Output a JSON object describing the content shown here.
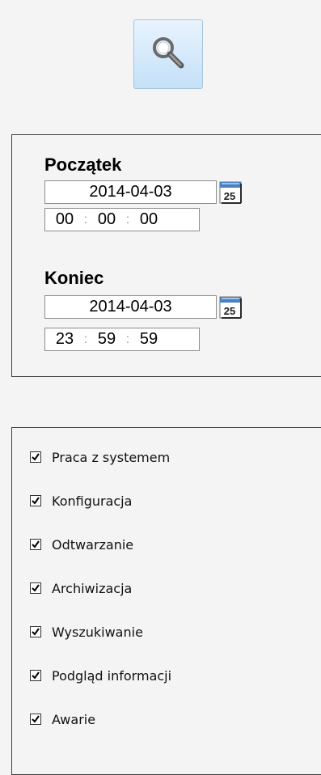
{
  "search": {
    "icon": "magnifier-icon"
  },
  "dates": {
    "start": {
      "label": "Początek",
      "date": "2014-04-03",
      "hours": "00",
      "minutes": "00",
      "seconds": "00"
    },
    "end": {
      "label": "Koniec",
      "date": "2014-04-03",
      "hours": "23",
      "minutes": "59",
      "seconds": "59"
    },
    "time_separator": ":",
    "calendar_icon_text": "25"
  },
  "filters": [
    {
      "label": "Praca z systemem",
      "checked": true
    },
    {
      "label": "Konfiguracja",
      "checked": true
    },
    {
      "label": "Odtwarzanie",
      "checked": true
    },
    {
      "label": "Archiwizacja",
      "checked": true
    },
    {
      "label": "Wyszukiwanie",
      "checked": true
    },
    {
      "label": "Podgląd informacji",
      "checked": true
    },
    {
      "label": "Awarie",
      "checked": true
    }
  ]
}
